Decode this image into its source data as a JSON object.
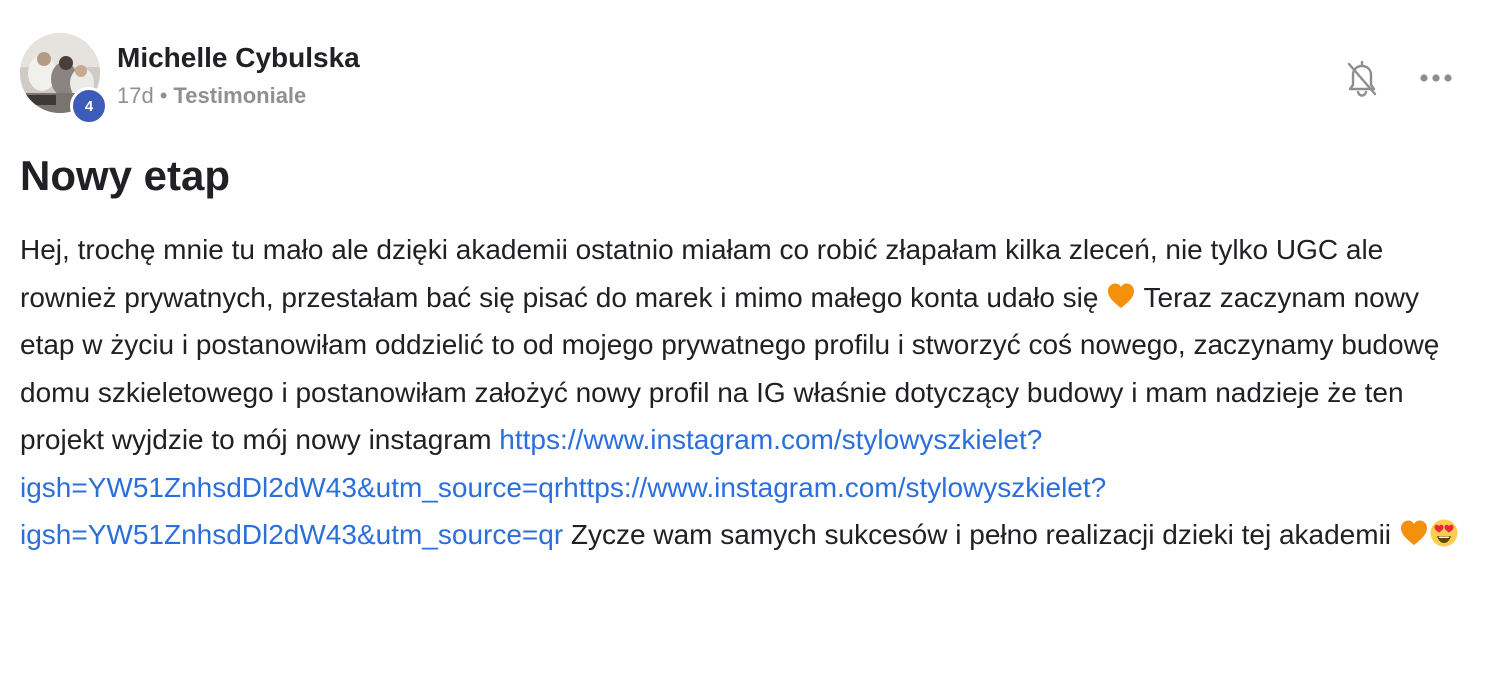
{
  "post": {
    "author": {
      "name": "Michelle Cybulska",
      "level": "4"
    },
    "time_ago": "17d",
    "separator": "•",
    "category": "Testimoniale",
    "title": "Nowy etap",
    "body": {
      "line1": "Hej, trochę mnie tu mało ale dzięki akademii ostatnio miałam co robić złapałam kilka zleceń, nie tylko UGC ale rownież prywatnych, przestałam bać się pisać do marek i mimo małego konta udało się ",
      "line2": " Teraz zaczynam nowy etap w życiu i postanowiłam oddzielić to od mojego prywatnego profilu i stworzyć coś nowego, zaczynamy budowę domu szkieletowego i postanowiłam założyć nowy profil na IG właśnie dotyczący budowy i mam nadzieje że ten projekt wyjdzie to mój nowy instagram ",
      "link_text": "https://www.instagram.com/stylowyszkielet?igsh=YW51ZnhsdDl2dW43&utm_source=qrhttps://www.instagram.com/stylowyszkielet?igsh=YW51ZnhsdDl2dW43&utm_source=qr",
      "line3": " Zycze wam samych sukcesów i pełno realizacji dzieki tej akademii "
    },
    "icons": {
      "bell": "bell-off-icon",
      "more": "more-horizontal-icon",
      "heart_emoji": "orange-heart-emoji",
      "heart_eyes_emoji": "heart-eyes-emoji"
    },
    "colors": {
      "link": "#2a6fdb",
      "badge": "#3d5bb8",
      "meta_gray": "#909090",
      "heart": "#f4900c"
    }
  }
}
